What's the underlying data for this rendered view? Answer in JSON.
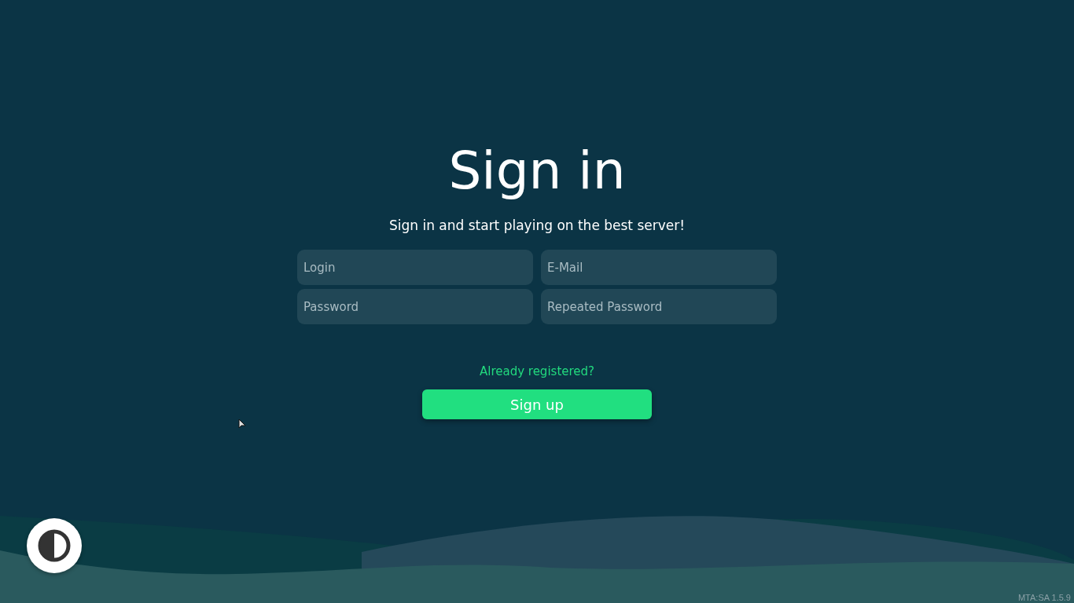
{
  "title": "Sign in",
  "subtitle": "Sign in and start playing on the best server!",
  "fields": [
    {
      "placeholder": "Login"
    },
    {
      "placeholder": "E-Mail"
    },
    {
      "placeholder": "Password"
    },
    {
      "placeholder": "Repeated Password"
    }
  ],
  "link": "Already registered?",
  "button": "Sign up",
  "version": "MTA:SA 1.5.9"
}
